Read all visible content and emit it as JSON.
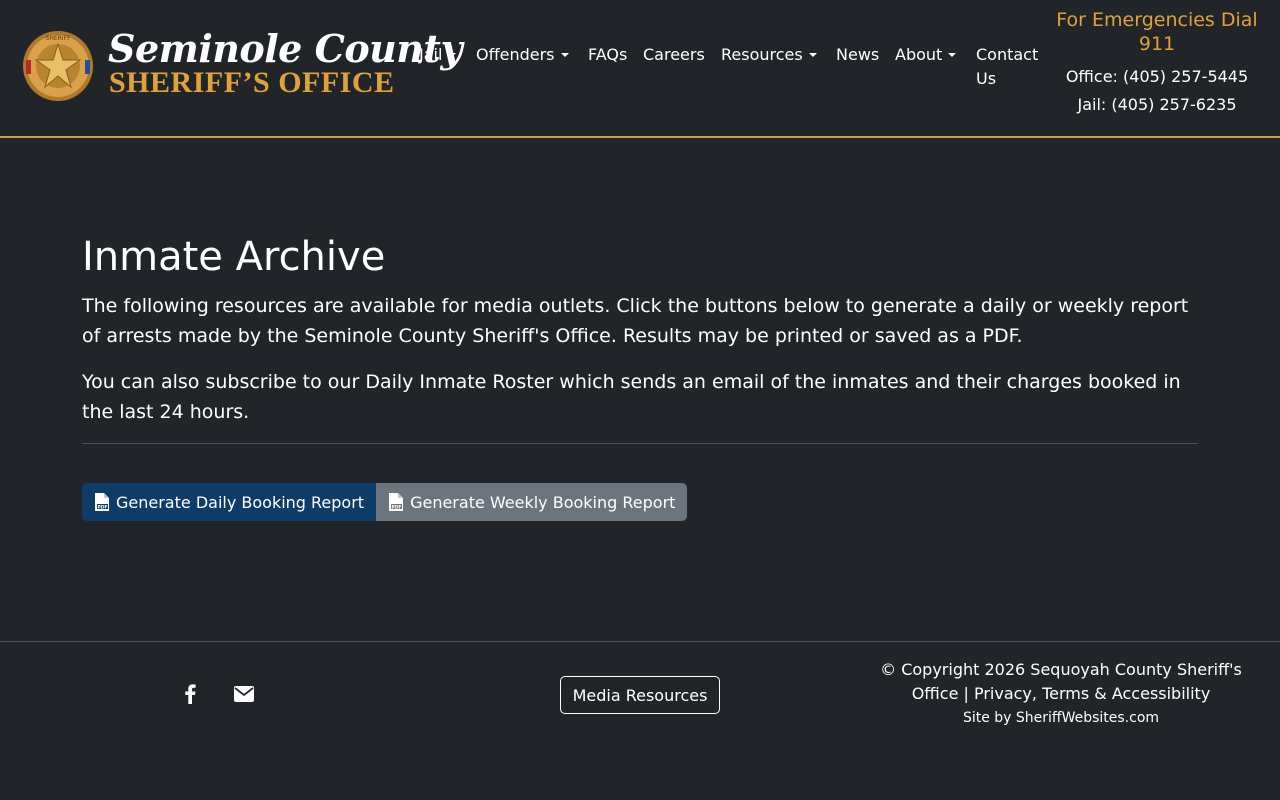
{
  "header": {
    "logo": {
      "line1": "Seminole County",
      "line2": "SHERIFF’S OFFICE",
      "badge_text": "SHERIFF"
    },
    "nav": [
      {
        "label": "Jail",
        "dropdown": true
      },
      {
        "label": "Offenders",
        "dropdown": true
      },
      {
        "label": "FAQs",
        "dropdown": false
      },
      {
        "label": "Careers",
        "dropdown": false
      },
      {
        "label": "Resources",
        "dropdown": true
      },
      {
        "label": "News",
        "dropdown": false
      },
      {
        "label": "About",
        "dropdown": true
      },
      {
        "label": "Contact",
        "label2": "Us",
        "dropdown": false
      }
    ],
    "emergency": "For Emergencies Dial 911",
    "office_label": "Office:",
    "office_phone": "(405) 257-5445",
    "jail_label": "Jail:",
    "jail_phone": "(405) 257-6235"
  },
  "main": {
    "title": "Inmate Archive",
    "intro": "The following resources are available for media outlets. Click the buttons below to generate a daily or weekly report of arrests made by the Seminole County Sheriff's Office. Results may be printed or saved as a PDF.",
    "subscribe_pre": "You can also subscribe to our ",
    "subscribe_link": "Daily Inmate Roster",
    "subscribe_post": " which sends an email of the inmates and their charges booked in the last 24 hours.",
    "daily_button": "Generate Daily Booking Report",
    "weekly_button": "Generate Weekly Booking Report",
    "pdf_icon_text": "PDF"
  },
  "footer": {
    "media_button": "Media Resources",
    "copyright": "© Copyright 2026 Sequoyah County Sheriff's Office | ",
    "privacy_link": "Privacy, Terms & Accessibility",
    "site_by": "Site by SheriffWebsites.com"
  },
  "icons": {
    "facebook": "facebook-icon",
    "email": "envelope-icon",
    "pdf": "file-pdf-icon"
  },
  "colors": {
    "background": "#212529",
    "accent_gold": "#e0a236",
    "header_border": "#c9a04a",
    "primary_button": "#0e3c68",
    "secondary_button": "#6c757d"
  }
}
